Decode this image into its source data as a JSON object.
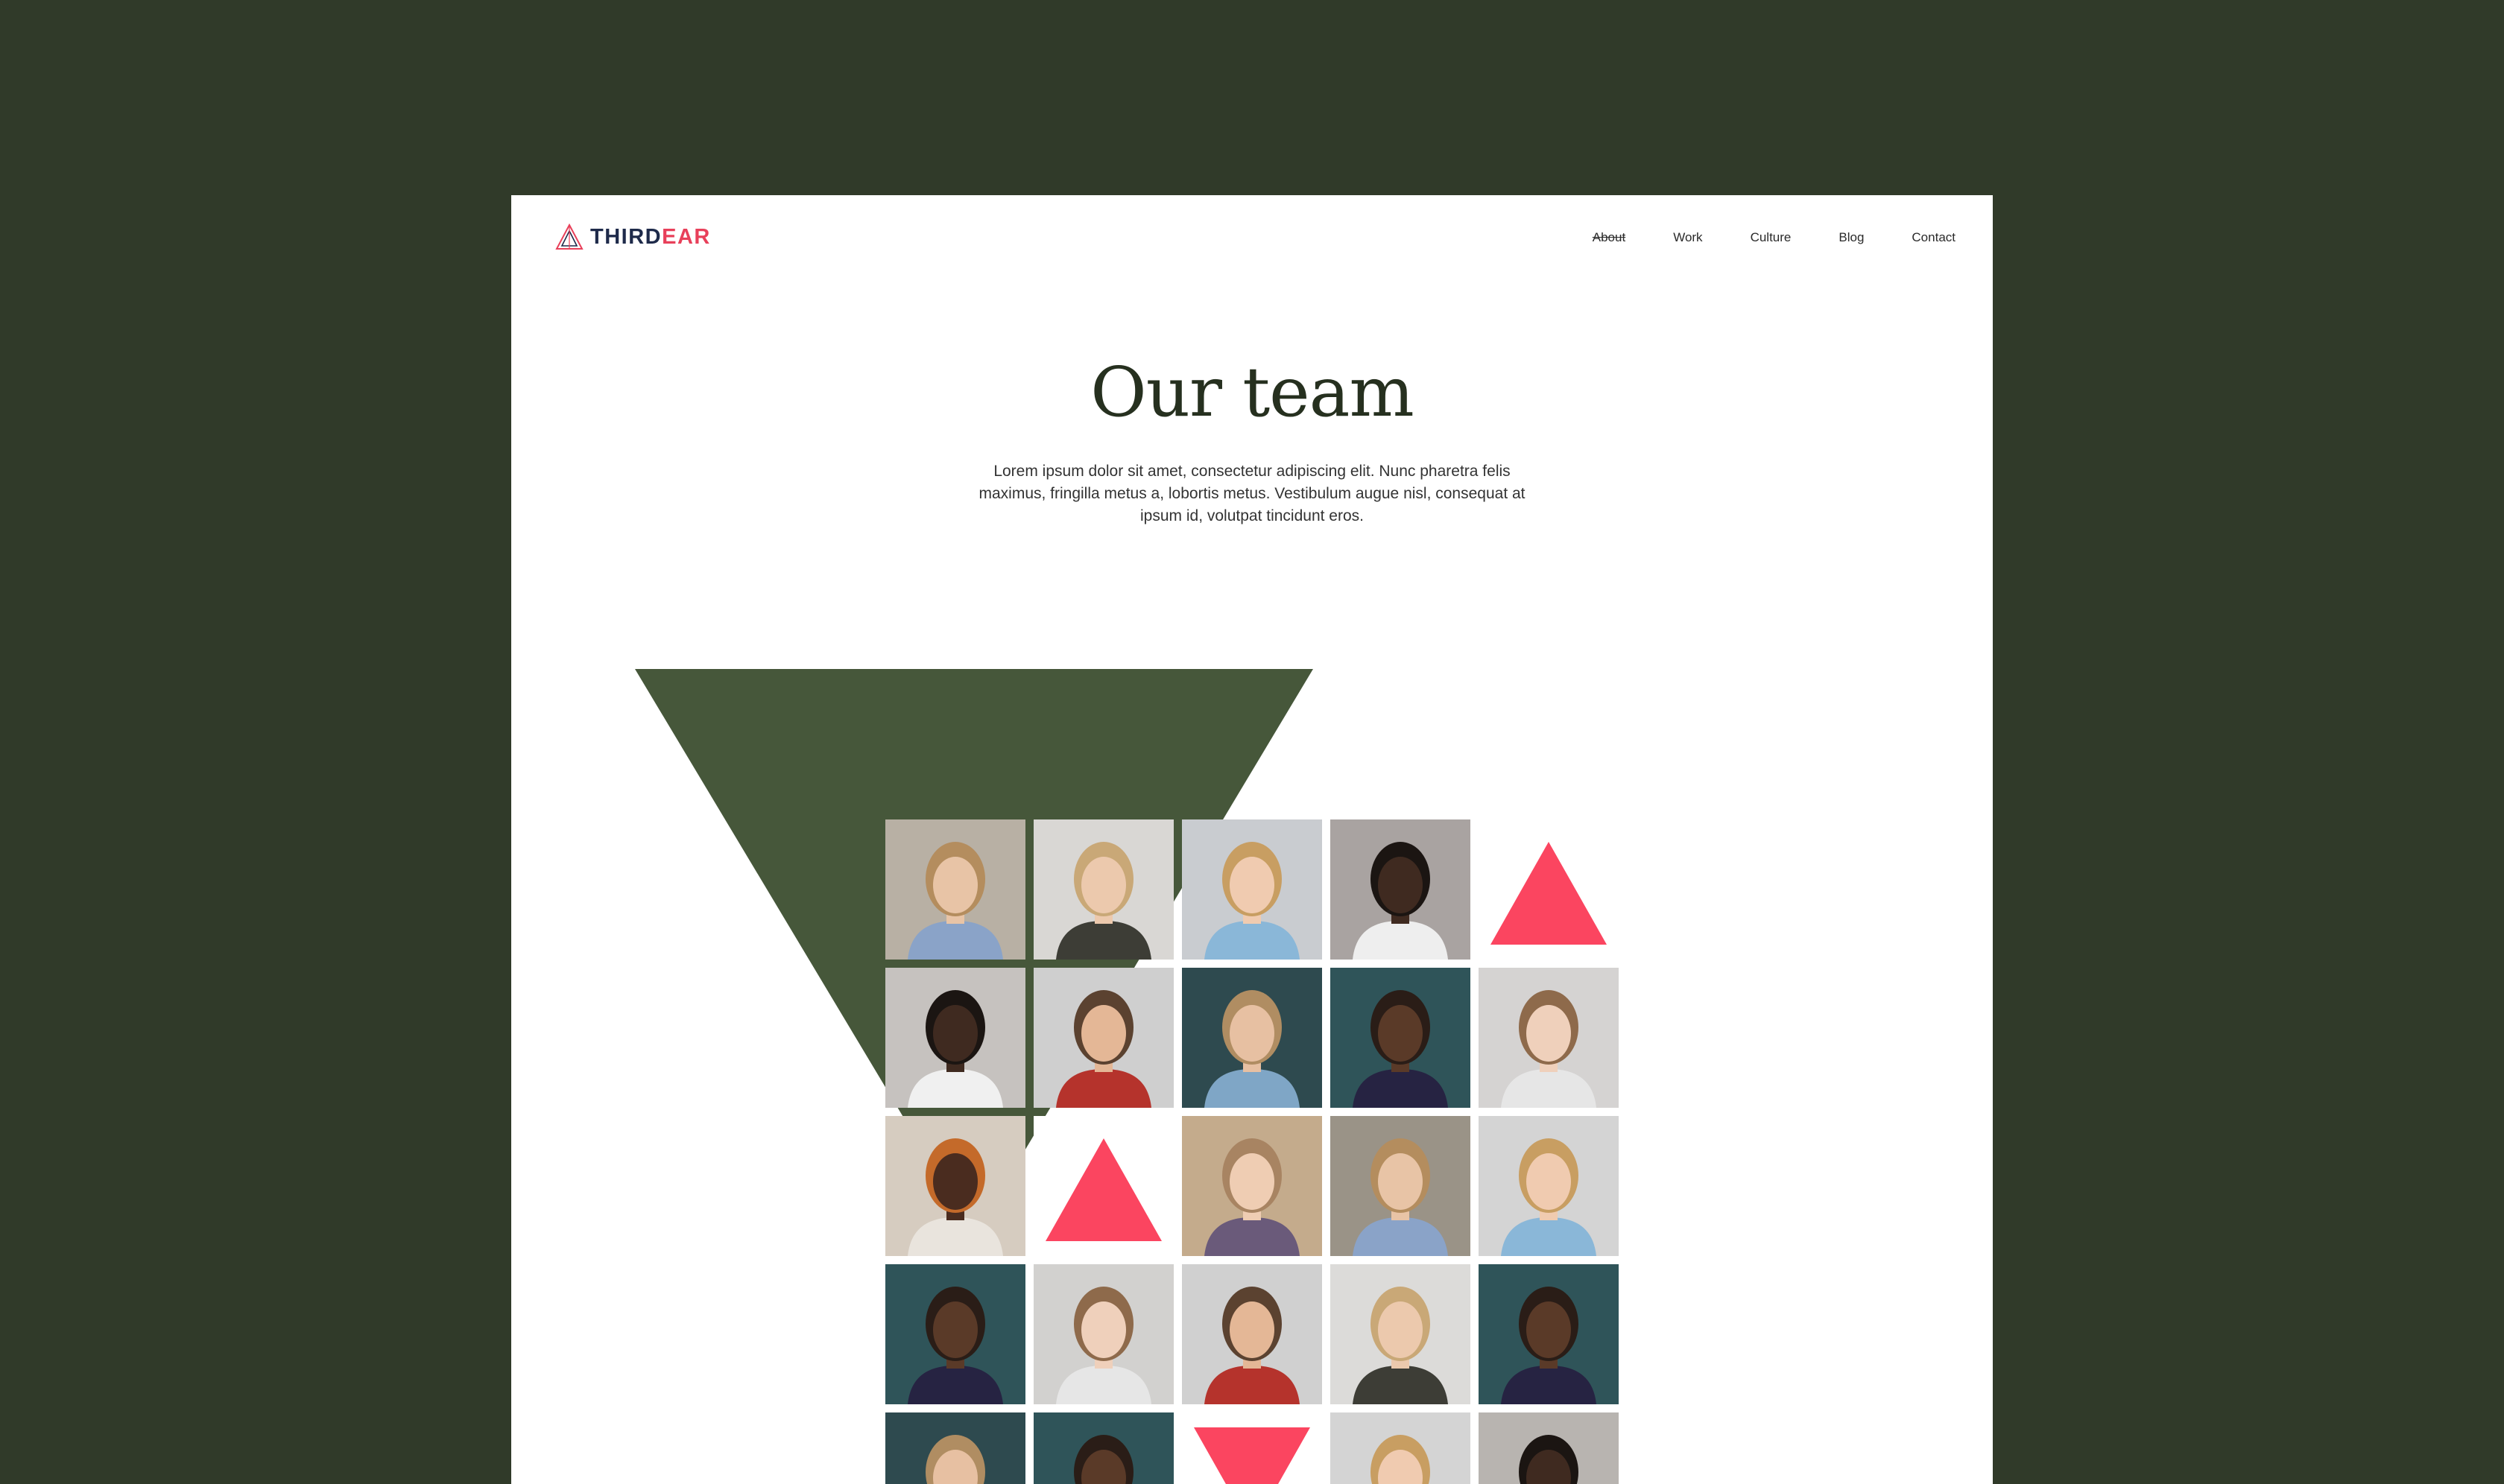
{
  "logo": {
    "text_a": "THIRD",
    "text_b": "EAR"
  },
  "nav": [
    {
      "label": "About",
      "active": true
    },
    {
      "label": "Work"
    },
    {
      "label": "Culture"
    },
    {
      "label": "Blog"
    },
    {
      "label": "Contact"
    }
  ],
  "hero": {
    "title": "Our team",
    "subtitle": "Lorem ipsum dolor sit amet, consectetur adipiscing elit. Nunc pharetra felis maximus, fringilla metus a, lobortis metus. Vestibulum augue nisl, consequat at ipsum id, volutpat tincidunt eros."
  },
  "colors": {
    "page_bg": "#303a29",
    "accent_green": "#46573a",
    "accent_red": "#fb4560",
    "logo_dark": "#1e2a4a",
    "logo_red": "#e8405a"
  },
  "team_grid": [
    {
      "type": "photo",
      "bg": "#b8b0a4",
      "hair": "#b48d5e",
      "skin": "#e8c4a6",
      "shirt": "#8aa3c8"
    },
    {
      "type": "photo",
      "bg": "#d9d7d4",
      "hair": "#c9a877",
      "skin": "#ecc9ad",
      "shirt": "#3d3d36"
    },
    {
      "type": "photo",
      "bg": "#c9ccd0",
      "hair": "#c89e62",
      "skin": "#f0cbb0",
      "shirt": "#8ab7d8"
    },
    {
      "type": "photo",
      "bg": "#a9a3a1",
      "hair": "#1b1512",
      "skin": "#3f2a20",
      "shirt": "#eeeeee"
    },
    {
      "type": "triangle-up"
    },
    {
      "type": "photo",
      "bg": "#c6c2bf",
      "hair": "#1b1512",
      "skin": "#3f2a20",
      "shirt": "#f0f0f0"
    },
    {
      "type": "photo",
      "bg": "#cfcfcf",
      "hair": "#5b4230",
      "skin": "#e4b796",
      "shirt": "#b5332c"
    },
    {
      "type": "photo",
      "bg": "#2e4a4f",
      "hair": "#b08d62",
      "skin": "#e7c0a2",
      "shirt": "#7fa6c6"
    },
    {
      "type": "photo",
      "bg": "#2f5459",
      "hair": "#2a1d17",
      "skin": "#5a3a28",
      "shirt": "#262342"
    },
    {
      "type": "photo",
      "bg": "#d5d3d2",
      "hair": "#8e6a4b",
      "skin": "#efd0bb",
      "shirt": "#e6e6e6"
    },
    {
      "type": "photo",
      "bg": "#d6ccc0",
      "hair": "#c46a2a",
      "skin": "#4a2c1f",
      "shirt": "#e9e4dd"
    },
    {
      "type": "triangle-up"
    },
    {
      "type": "photo",
      "bg": "#c4ab8c",
      "hair": "#a88462",
      "skin": "#efcdb3",
      "shirt": "#6a5a7a"
    },
    {
      "type": "photo",
      "bg": "#9a9387",
      "hair": "#b48d5e",
      "skin": "#e8c4a6",
      "shirt": "#8aa3c8"
    },
    {
      "type": "photo",
      "bg": "#d4d4d4",
      "hair": "#c89e62",
      "skin": "#f0cbb0",
      "shirt": "#8ab7d8"
    },
    {
      "type": "photo",
      "bg": "#2f5459",
      "hair": "#2a1d17",
      "skin": "#5a3a28",
      "shirt": "#262342"
    },
    {
      "type": "photo",
      "bg": "#d2d1cf",
      "hair": "#8e6a4b",
      "skin": "#efd0bb",
      "shirt": "#e6e6e6"
    },
    {
      "type": "photo",
      "bg": "#d0d0d0",
      "hair": "#5b4230",
      "skin": "#e4b796",
      "shirt": "#b5332c"
    },
    {
      "type": "photo",
      "bg": "#dcdbd9",
      "hair": "#c9a877",
      "skin": "#ecc9ad",
      "shirt": "#3d3d36"
    },
    {
      "type": "photo",
      "bg": "#2f5459",
      "hair": "#2a1d17",
      "skin": "#5a3a28",
      "shirt": "#262342"
    },
    {
      "type": "photo",
      "bg": "#2e4a4f",
      "hair": "#b08d62",
      "skin": "#e7c0a2",
      "shirt": "#7fa6c6"
    },
    {
      "type": "photo",
      "bg": "#2f5459",
      "hair": "#2a1d17",
      "skin": "#5a3a28",
      "shirt": "#262342"
    },
    {
      "type": "triangle-down"
    },
    {
      "type": "photo",
      "bg": "#d4d4d4",
      "hair": "#c89e62",
      "skin": "#f0cbb0",
      "shirt": "#8ab7d8"
    },
    {
      "type": "photo",
      "bg": "#b8b4b0",
      "hair": "#1b1512",
      "skin": "#3f2a20",
      "shirt": "#2d2d2d"
    }
  ]
}
